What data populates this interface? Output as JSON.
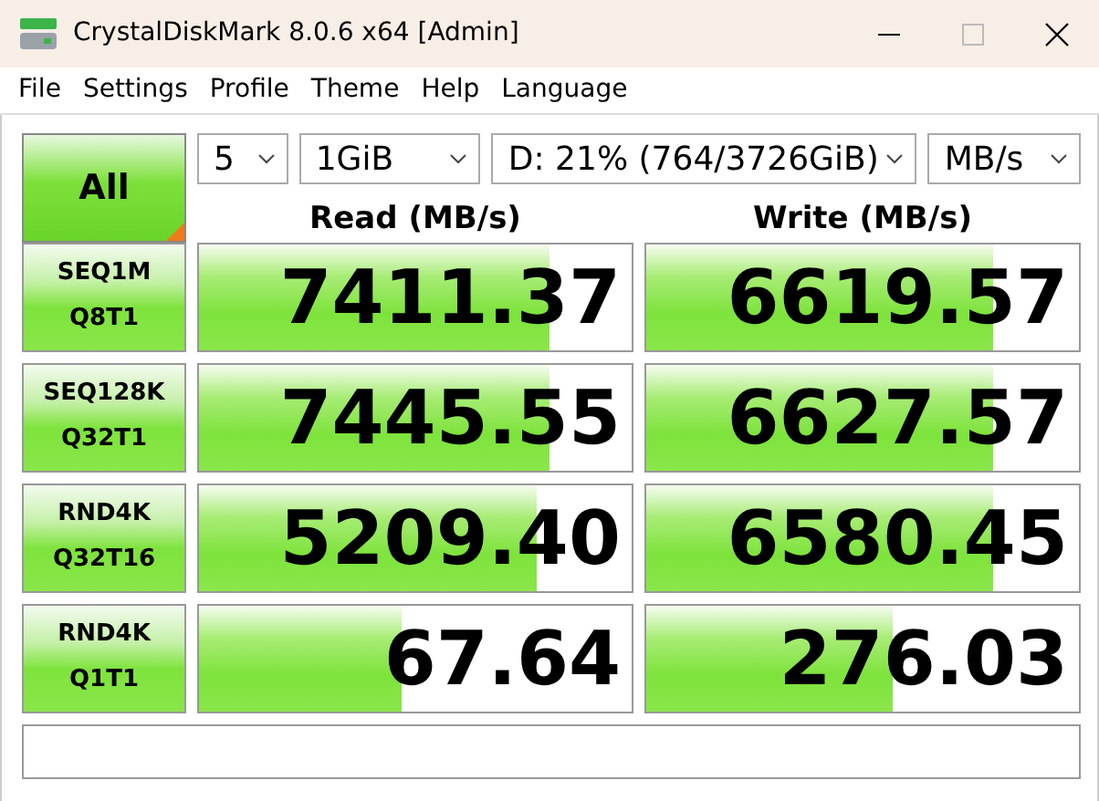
{
  "window": {
    "title": "CrystalDiskMark 8.0.6 x64 [Admin]"
  },
  "menu": [
    "File",
    "Settings",
    "Profile",
    "Theme",
    "Help",
    "Language"
  ],
  "all_button": {
    "label": "All"
  },
  "selects": [
    {
      "value": "5"
    },
    {
      "value": "1GiB"
    },
    {
      "value": "D: 21% (764/3726GiB)"
    },
    {
      "value": "MB/s"
    }
  ],
  "columns": [
    "Read (MB/s)",
    "Write (MB/s)"
  ],
  "tests": [
    {
      "line1": "SEQ1M",
      "line2": "Q8T1",
      "read": {
        "value": "7411.37",
        "level": 0.81
      },
      "write": {
        "value": "6619.57",
        "level": 0.8
      }
    },
    {
      "line1": "SEQ128K",
      "line2": "Q32T1",
      "read": {
        "value": "7445.55",
        "level": 0.81
      },
      "write": {
        "value": "6627.57",
        "level": 0.8
      }
    },
    {
      "line1": "RND4K",
      "line2": "Q32T16",
      "read": {
        "value": "5209.40",
        "level": 0.78
      },
      "write": {
        "value": "6580.45",
        "level": 0.8
      }
    },
    {
      "line1": "RND4K",
      "line2": "Q1T1",
      "read": {
        "value": "67.64",
        "level": 0.47
      },
      "write": {
        "value": "276.03",
        "level": 0.57
      }
    }
  ]
}
